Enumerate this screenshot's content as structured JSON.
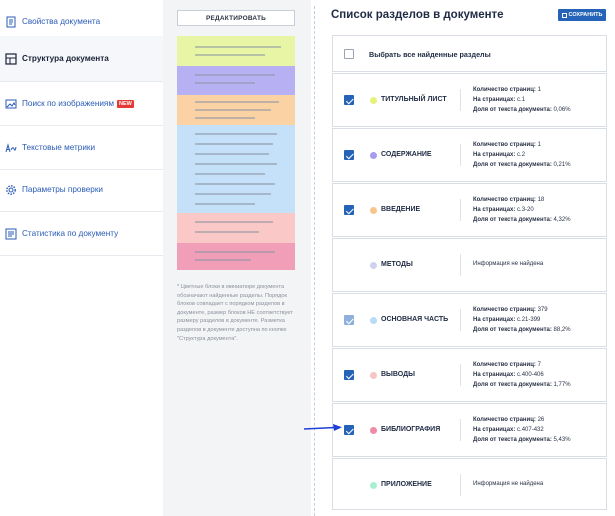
{
  "sidebar": {
    "items": [
      {
        "label": "Свойства документа",
        "icon": "document-properties-icon",
        "active": false,
        "badge": ""
      },
      {
        "label": "Структура документа",
        "icon": "document-structure-icon",
        "active": true,
        "badge": ""
      },
      {
        "label": "Поиск по изображениям",
        "icon": "image-search-icon",
        "active": false,
        "badge": "NEW"
      },
      {
        "label": "Текстовые метрики",
        "icon": "text-metrics-icon",
        "active": false,
        "badge": ""
      },
      {
        "label": "Параметры проверки",
        "icon": "settings-gear-icon",
        "active": false,
        "badge": ""
      },
      {
        "label": "Статистика по документу",
        "icon": "statistics-icon",
        "active": false,
        "badge": ""
      }
    ]
  },
  "middle": {
    "edit_label": "РЕДАКТИРОВАТЬ",
    "note": "* Цветные блоки в миниатюре документа обозначают найденные разделы. Порядок блоков совпадает с порядком разделов в документе, размер блоков НЕ соответствует размеру разделов в документе. Разметка разделов в документе доступна по кнопке \"Структура документа\".",
    "block_colors": [
      "#e8f5a5",
      "#b7b1f3",
      "#fbd2a4",
      "#c4e1f9",
      "#fbc8c8",
      "#f19eb9"
    ]
  },
  "header": {
    "title": "Список разделов в документе",
    "save_label": "СОХРАНИТЬ"
  },
  "select_all": {
    "label": "Выбрать все найденные разделы",
    "checked": false
  },
  "stat_labels": {
    "pages": "Количество страниц:",
    "on_pages": "На страницах:",
    "share": "Доля от текста документа:"
  },
  "sections": [
    {
      "name": "ТИТУЛЬНЫЙ ЛИСТ",
      "color": "#e6f27a",
      "checked": "on",
      "found": true,
      "pages": "1",
      "on_pages": "с.1",
      "share": "0,06%"
    },
    {
      "name": "СОДЕРЖАНИЕ",
      "color": "#a59bf0",
      "checked": "on",
      "found": true,
      "pages": "1",
      "on_pages": "с.2",
      "share": "0,21%"
    },
    {
      "name": "ВВЕДЕНИЕ",
      "color": "#f9c58a",
      "checked": "on",
      "found": true,
      "pages": "18",
      "on_pages": "с.3-20",
      "share": "4,32%"
    },
    {
      "name": "МЕТОДЫ",
      "color": "#cfd2ee",
      "checked": "none",
      "found": false,
      "not_found": "Информация не найдена"
    },
    {
      "name": "ОСНОВНАЯ ЧАСТЬ",
      "color": "#b9dcf6",
      "checked": "dim",
      "found": true,
      "pages": "379",
      "on_pages": "с.21-399",
      "share": "88,2%"
    },
    {
      "name": "ВЫВОДЫ",
      "color": "#f7c5c5",
      "checked": "on",
      "found": true,
      "pages": "7",
      "on_pages": "с.400-406",
      "share": "1,77%"
    },
    {
      "name": "БИБЛИОГРАФИЯ",
      "color": "#ef8ba6",
      "checked": "on",
      "found": true,
      "pages": "26",
      "on_pages": "с.407-432",
      "share": "5,43%"
    },
    {
      "name": "ПРИЛОЖЕНИЕ",
      "color": "#a8f0cf",
      "checked": "none",
      "found": false,
      "not_found": "Информация не найдена"
    }
  ],
  "colors": {
    "accent": "#2563b8",
    "link": "#2a5bb7",
    "arrow": "#1f3fd6"
  }
}
